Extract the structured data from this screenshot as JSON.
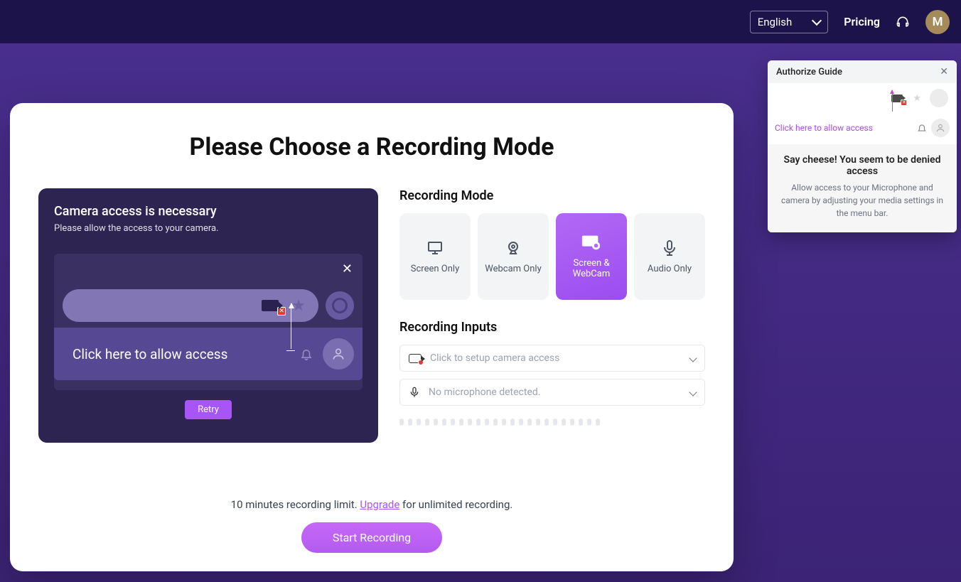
{
  "header": {
    "language": "English",
    "pricing": "Pricing",
    "avatar_initial": "M"
  },
  "main": {
    "title": "Please Choose a Recording Mode",
    "camera_panel": {
      "heading": "Camera access is necessary",
      "sub": "Please allow the access to your camera.",
      "hint": "Click here to allow access",
      "retry": "Retry"
    },
    "mode_section_title": "Recording Mode",
    "modes": {
      "screen": "Screen Only",
      "webcam": "Webcam Only",
      "both": "Screen & WebCam",
      "audio": "Audio Only"
    },
    "inputs_section_title": "Recording Inputs",
    "camera_input": "Click to setup camera access",
    "mic_input": "No microphone detected.",
    "limit_note_pre": "10 minutes recording limit. ",
    "upgrade": "Upgrade",
    "limit_note_post": " for unlimited recording.",
    "start": "Start Recording"
  },
  "popup": {
    "title": "Authorize Guide",
    "link": "Click here to allow access",
    "heading": "Say cheese! You seem to be denied access",
    "desc": "Allow access to your Microphone and camera by adjusting your media settings in the menu bar."
  }
}
